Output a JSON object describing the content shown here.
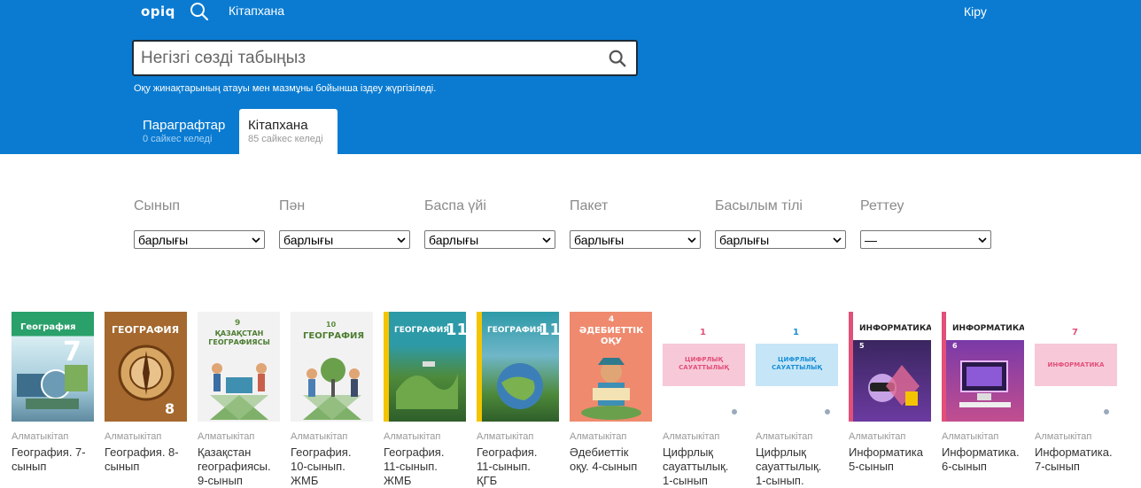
{
  "header": {
    "logo": "opiq",
    "nav_library": "Кітапхана",
    "login": "Кіру",
    "bg_color": "#0a7bd1"
  },
  "search": {
    "placeholder": "Негізгі сөзді табыңыз",
    "hint": "Оқу жинақтарының атауы мен мазмұны бойынша іздеу жүргізіледі."
  },
  "tabs": [
    {
      "title": "Параграфтар",
      "sub": "0 сайкес келеді",
      "active": false
    },
    {
      "title": "Кітапхана",
      "sub": "85 сайкес келеді",
      "active": true
    }
  ],
  "filters": [
    {
      "label": "Сынып",
      "value": "барлығы"
    },
    {
      "label": "Пән",
      "value": "барлығы"
    },
    {
      "label": "Баспа үйі",
      "value": "барлығы"
    },
    {
      "label": "Пакет",
      "value": "барлығы"
    },
    {
      "label": "Басылым тілі",
      "value": "барлығы"
    },
    {
      "label": "Реттеу",
      "value": "—"
    }
  ],
  "books": [
    {
      "publisher": "Алматыкітап",
      "title_lines": [
        "География. 7-",
        "сынып"
      ],
      "cover_text": "География",
      "cover_num": "7"
    },
    {
      "publisher": "Алматыкітап",
      "title_lines": [
        "География. 8-",
        "сынып"
      ],
      "cover_text": "ГЕОГРАФИЯ",
      "cover_num": "8"
    },
    {
      "publisher": "Алматыкітап",
      "title_lines": [
        "Қазақстан",
        "географиясы.",
        "9-сынып"
      ],
      "cover_text": "ҚАЗАҚСТАН ГЕОГРАФИЯСЫ",
      "cover_num": "9"
    },
    {
      "publisher": "Алматыкітап",
      "title_lines": [
        "География.",
        "10-сынып.",
        "ЖМБ"
      ],
      "cover_text": "ГЕОГРАФИЯ",
      "cover_num": "10"
    },
    {
      "publisher": "Алматыкітап",
      "title_lines": [
        "География.",
        "11-сынып.",
        "ЖМБ"
      ],
      "cover_text": "ГЕОГРАФИЯ",
      "cover_num": "11"
    },
    {
      "publisher": "Алматыкітап",
      "title_lines": [
        "География.",
        "11-сынып.",
        "ҚГБ"
      ],
      "cover_text": "ГЕОГРАФИЯ",
      "cover_num": "11"
    },
    {
      "publisher": "Алматыкітап",
      "title_lines": [
        "Әдебиеттік",
        "оқу. 4-сынып"
      ],
      "cover_text": "ӘДЕБИЕТТІК ОҚУ",
      "cover_num": "4"
    },
    {
      "publisher": "Алматыкітап",
      "title_lines": [
        "Цифрлық",
        "сауаттылық.",
        "1-сынып"
      ],
      "cover_text": "ЦИФРЛЫҚ САУАТТЫЛЫҚ",
      "cover_num": "1"
    },
    {
      "publisher": "Алматыкітап",
      "title_lines": [
        "Цифрлық",
        "сауаттылық.",
        "1-сынып."
      ],
      "cover_text": "ЦИФРЛЫҚ САУАТТЫЛЫҚ",
      "cover_num": "1"
    },
    {
      "publisher": "Алматыкітап",
      "title_lines": [
        "Информатика",
        "5-сынып"
      ],
      "cover_text": "ИНФОРМАТИКА",
      "cover_num": "5"
    },
    {
      "publisher": "Алматыкітап",
      "title_lines": [
        "Информатика.",
        "6-сынып"
      ],
      "cover_text": "ИНФОРМАТИКА",
      "cover_num": "6"
    },
    {
      "publisher": "Алматыкітап",
      "title_lines": [
        "Информатика.",
        "7-сынып"
      ],
      "cover_text": "ИНФОРМАТИКА",
      "cover_num": "7"
    }
  ]
}
